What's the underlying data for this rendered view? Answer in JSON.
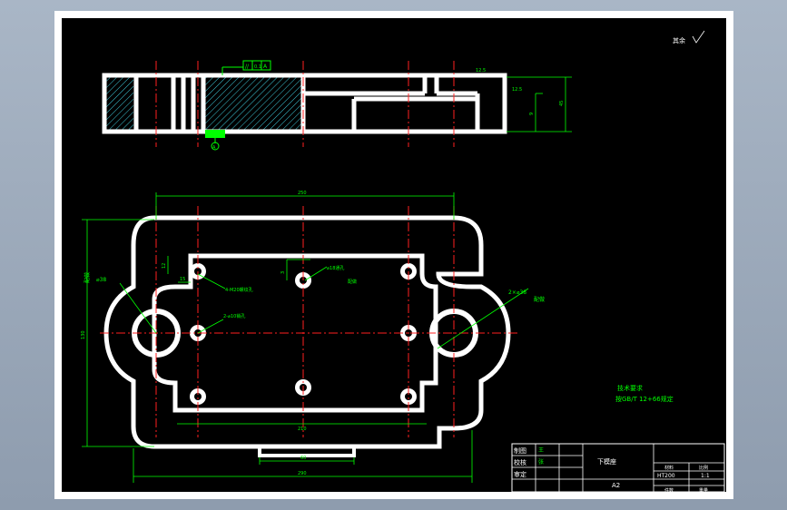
{
  "drawing": {
    "roughness_label": "其余",
    "surface_note": "12.5",
    "section_flatness_frame": [
      "//",
      "0.1",
      "A"
    ],
    "datum_marker": "A",
    "dims": {
      "overall_length": "290",
      "hole_span_top": "250",
      "hole_span_bottom": "210",
      "height_left": "130",
      "slot_width": "60",
      "cross_dim_bottom": "290",
      "side_height_a": "9",
      "side_height_b": "45",
      "small_12": "12",
      "small_3": "3",
      "small_15": "15"
    },
    "callouts": {
      "left_hole": "⌀38",
      "left_fit": "配做",
      "right_hole": "2×⌀38",
      "right_fit": "配做",
      "pilot_holes": "⌀18通孔",
      "pilot_fit": "配做",
      "tap_holes": "4-M20螺纹孔",
      "pin_holes": "2-⌀10销孔"
    },
    "tech_req_title": "技术要求",
    "tech_req_body": "按GB/T 12+66规定"
  },
  "title_block": {
    "rows": [
      {
        "label": "制图",
        "name": "王"
      },
      {
        "label": "校核",
        "name": "张"
      },
      {
        "label": "审定",
        "name": ""
      }
    ],
    "part_name": "下模座",
    "sheet_size": "A2",
    "header_cols": [
      "材料",
      "比例"
    ],
    "material": "HT200",
    "scale": "1:1",
    "bottom_cols": [
      "件数",
      "重量"
    ]
  }
}
